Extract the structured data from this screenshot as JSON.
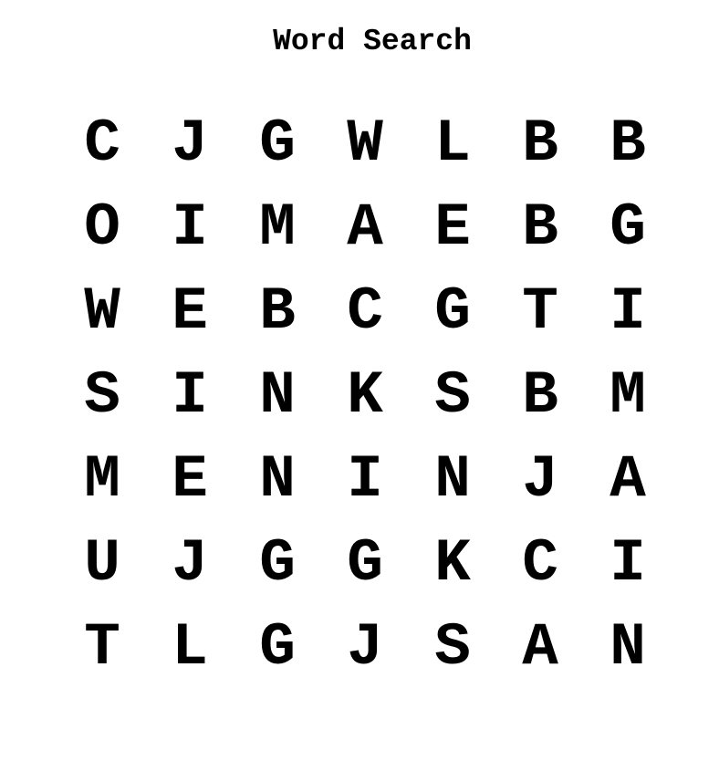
{
  "title": "Word Search",
  "grid": [
    [
      "C",
      "J",
      "G",
      "W",
      "L",
      "B",
      "B"
    ],
    [
      "O",
      "I",
      "M",
      "A",
      "E",
      "B",
      "G"
    ],
    [
      "W",
      "E",
      "B",
      "C",
      "G",
      "T",
      "I"
    ],
    [
      "S",
      "I",
      "N",
      "K",
      "S",
      "B",
      "M"
    ],
    [
      "M",
      "E",
      "N",
      "I",
      "N",
      "J",
      "A"
    ],
    [
      "U",
      "J",
      "G",
      "G",
      "K",
      "C",
      "I"
    ],
    [
      "T",
      "L",
      "G",
      "J",
      "S",
      "A",
      "N"
    ]
  ]
}
